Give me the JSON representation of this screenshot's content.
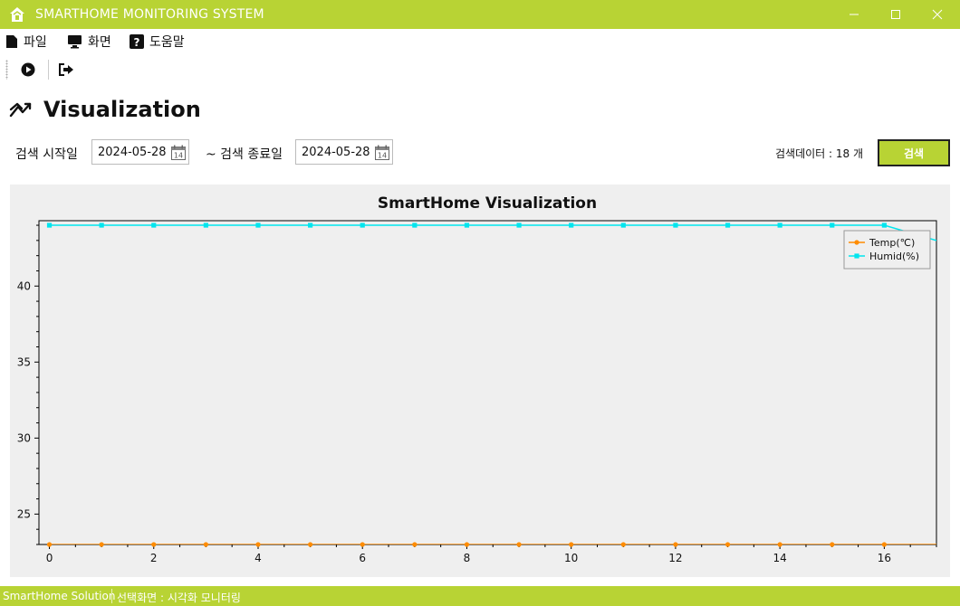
{
  "window": {
    "title": "SMARTHOME MONITORING SYSTEM",
    "minimize_icon": "minimize-icon",
    "maximize_icon": "maximize-icon",
    "close_icon": "close-icon"
  },
  "menu": [
    {
      "label": "파일",
      "icon": "file-icon"
    },
    {
      "label": "화면",
      "icon": "monitor-icon"
    },
    {
      "label": "도움말",
      "icon": "help-icon"
    }
  ],
  "toolbar": {
    "items": [
      {
        "icon": "play-circle-icon"
      },
      {
        "icon": "exit-icon"
      }
    ]
  },
  "page": {
    "title": "Visualization",
    "icon": "trend-icon"
  },
  "filters": {
    "start_label": "검색 시작일",
    "start_date": "2024-05-28",
    "end_label": "~ 검색 종료일",
    "end_date": "2024-05-28",
    "count_text": "검색데이터 : 18 개",
    "search_label": "검색"
  },
  "colors": {
    "accent": "#b8d334",
    "temp": "#ff8c00",
    "humid": "#00e5ee"
  },
  "chart_data": {
    "type": "line",
    "title": "SmartHome Visualization",
    "xlim": [
      -0.2,
      17
    ],
    "ylim": [
      23,
      44.3
    ],
    "x_ticks": [
      0,
      2,
      4,
      6,
      8,
      10,
      12,
      14,
      16
    ],
    "y_ticks": [
      25,
      30,
      35,
      40
    ],
    "x": [
      0,
      1,
      2,
      3,
      4,
      5,
      6,
      7,
      8,
      9,
      10,
      11,
      12,
      13,
      14,
      15,
      16,
      17
    ],
    "series": [
      {
        "name": "Temp(℃)",
        "marker": "circle",
        "color": "#ff8c00",
        "values": [
          23,
          23,
          23,
          23,
          23,
          23,
          23,
          23,
          23,
          23,
          23,
          23,
          23,
          23,
          23,
          23,
          23,
          23
        ]
      },
      {
        "name": "Humid(%)",
        "marker": "square",
        "color": "#00e5ee",
        "values": [
          44,
          44,
          44,
          44,
          44,
          44,
          44,
          44,
          44,
          44,
          44,
          44,
          44,
          44,
          44,
          44,
          44,
          43
        ]
      }
    ],
    "legend": "top-right",
    "grid": false
  },
  "status": {
    "app": "SmartHome Solution",
    "screen": "선택화면 : 시각화 모니터링"
  }
}
